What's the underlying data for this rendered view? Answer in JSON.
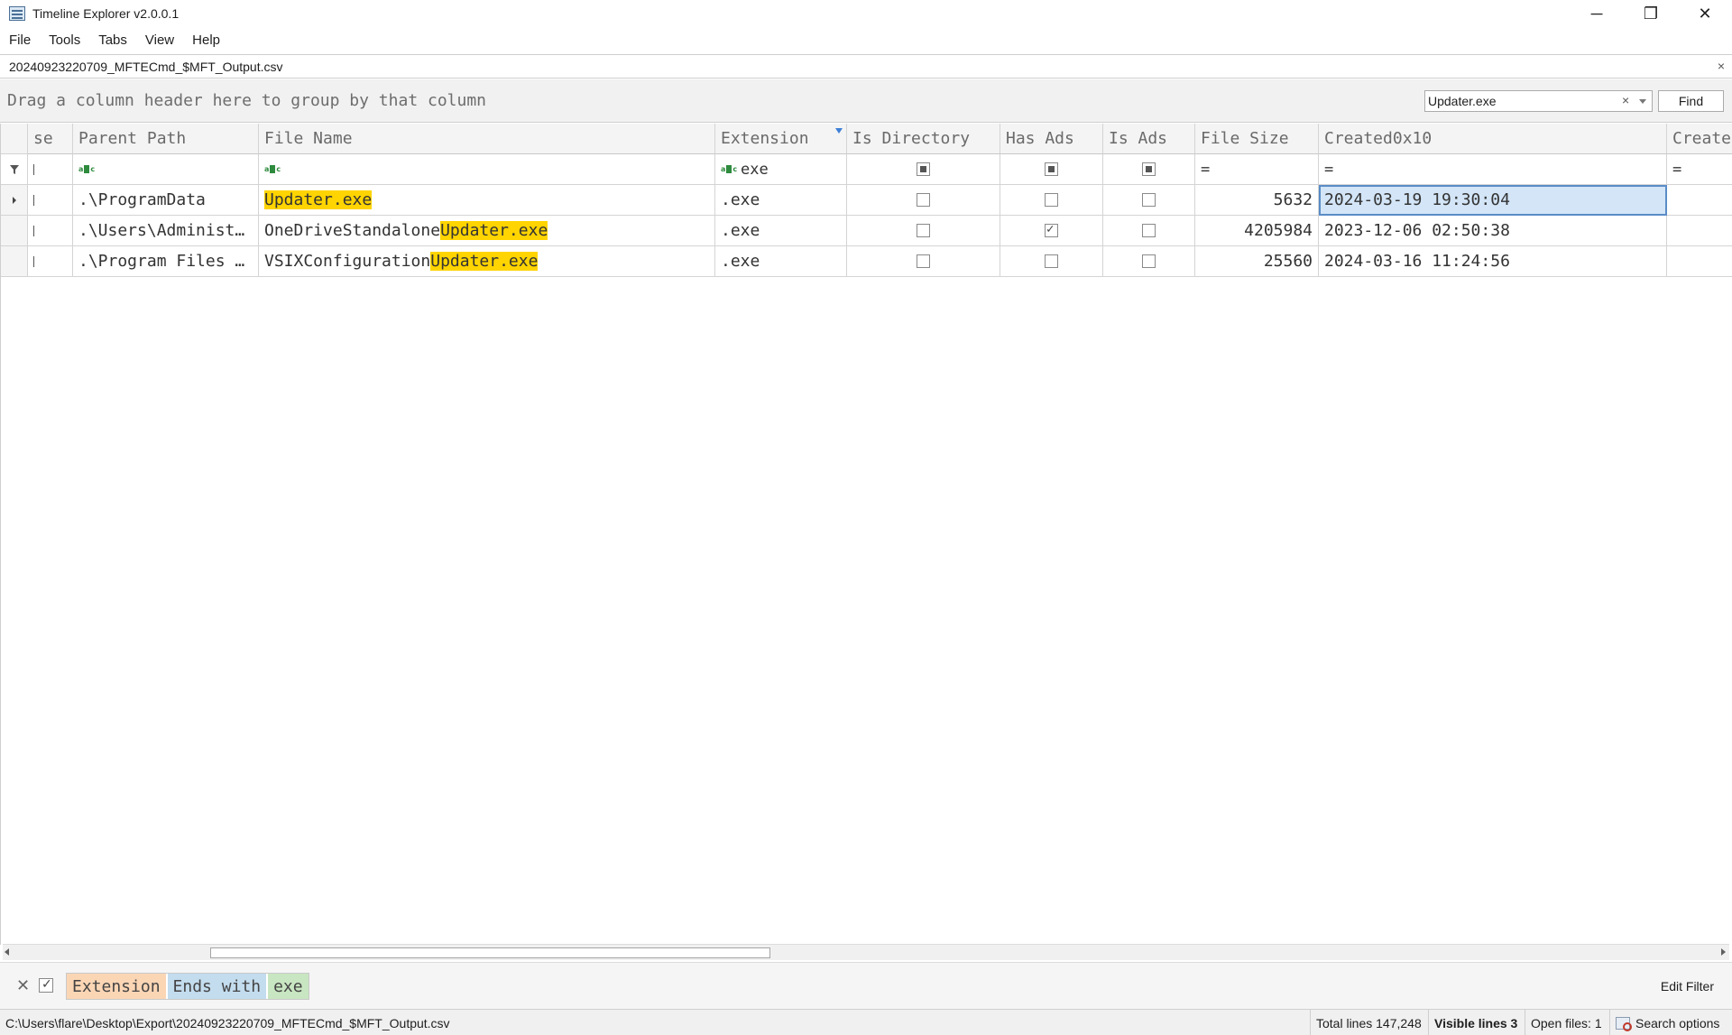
{
  "window": {
    "title": "Timeline Explorer v2.0.0.1",
    "minimize_glyph": "─",
    "maximize_glyph": "❐",
    "close_glyph": "✕"
  },
  "menu": [
    "File",
    "Tools",
    "Tabs",
    "View",
    "Help"
  ],
  "file_tab": {
    "label": "20240923220709_MFTECmd_$MFT_Output.csv",
    "close_glyph": "×"
  },
  "group_panel": {
    "hint": "Drag a column header here to group by that column"
  },
  "search": {
    "value": "Updater.exe",
    "clear_glyph": "×",
    "find_label": "Find"
  },
  "grid": {
    "columns": [
      "se",
      "Parent Path",
      "File Name",
      "Extension",
      "Is Directory",
      "Has Ads",
      "Is Ads",
      "File Size",
      "Created0x10",
      "Create"
    ],
    "filter_row": {
      "extension": "exe",
      "file_size": "=",
      "created": "=",
      "created2": "="
    },
    "rows": [
      {
        "parent": ".\\ProgramData",
        "name_prefix": "",
        "name_match": "Updater.exe",
        "ext": ".exe",
        "is_dir": false,
        "has_ads": false,
        "is_ads": false,
        "size": "5632",
        "created": "2024-03-19 19:30:04"
      },
      {
        "parent": ".\\Users\\Administ…",
        "name_prefix": "OneDriveStandalone",
        "name_match": "Updater.exe",
        "ext": ".exe",
        "is_dir": false,
        "has_ads": true,
        "is_ads": false,
        "size": "4205984",
        "created": "2023-12-06 02:50:38"
      },
      {
        "parent": ".\\Program Files …",
        "name_prefix": "VSIXConfiguration",
        "name_match": "Updater.exe",
        "ext": ".exe",
        "is_dir": false,
        "has_ads": false,
        "is_ads": false,
        "size": "25560",
        "created": "2024-03-16 11:24:56"
      }
    ]
  },
  "filter_bar": {
    "column": "Extension",
    "operator": "Ends with",
    "value": "exe",
    "edit_label": "Edit Filter",
    "close_glyph": "✕"
  },
  "status": {
    "path": "C:\\Users\\flare\\Desktop\\Export\\20240923220709_MFTECmd_$MFT_Output.csv",
    "total_lines": "Total lines 147,248",
    "visible_lines": "Visible lines 3",
    "open_files": "Open files: 1",
    "search_options": "Search options"
  },
  "colors": {
    "highlight": "#ffd400",
    "selection": "#d3e5f7",
    "filter_column": "#fbd6b5",
    "filter_operator": "#c3dcee",
    "filter_value": "#c8e6c1"
  }
}
